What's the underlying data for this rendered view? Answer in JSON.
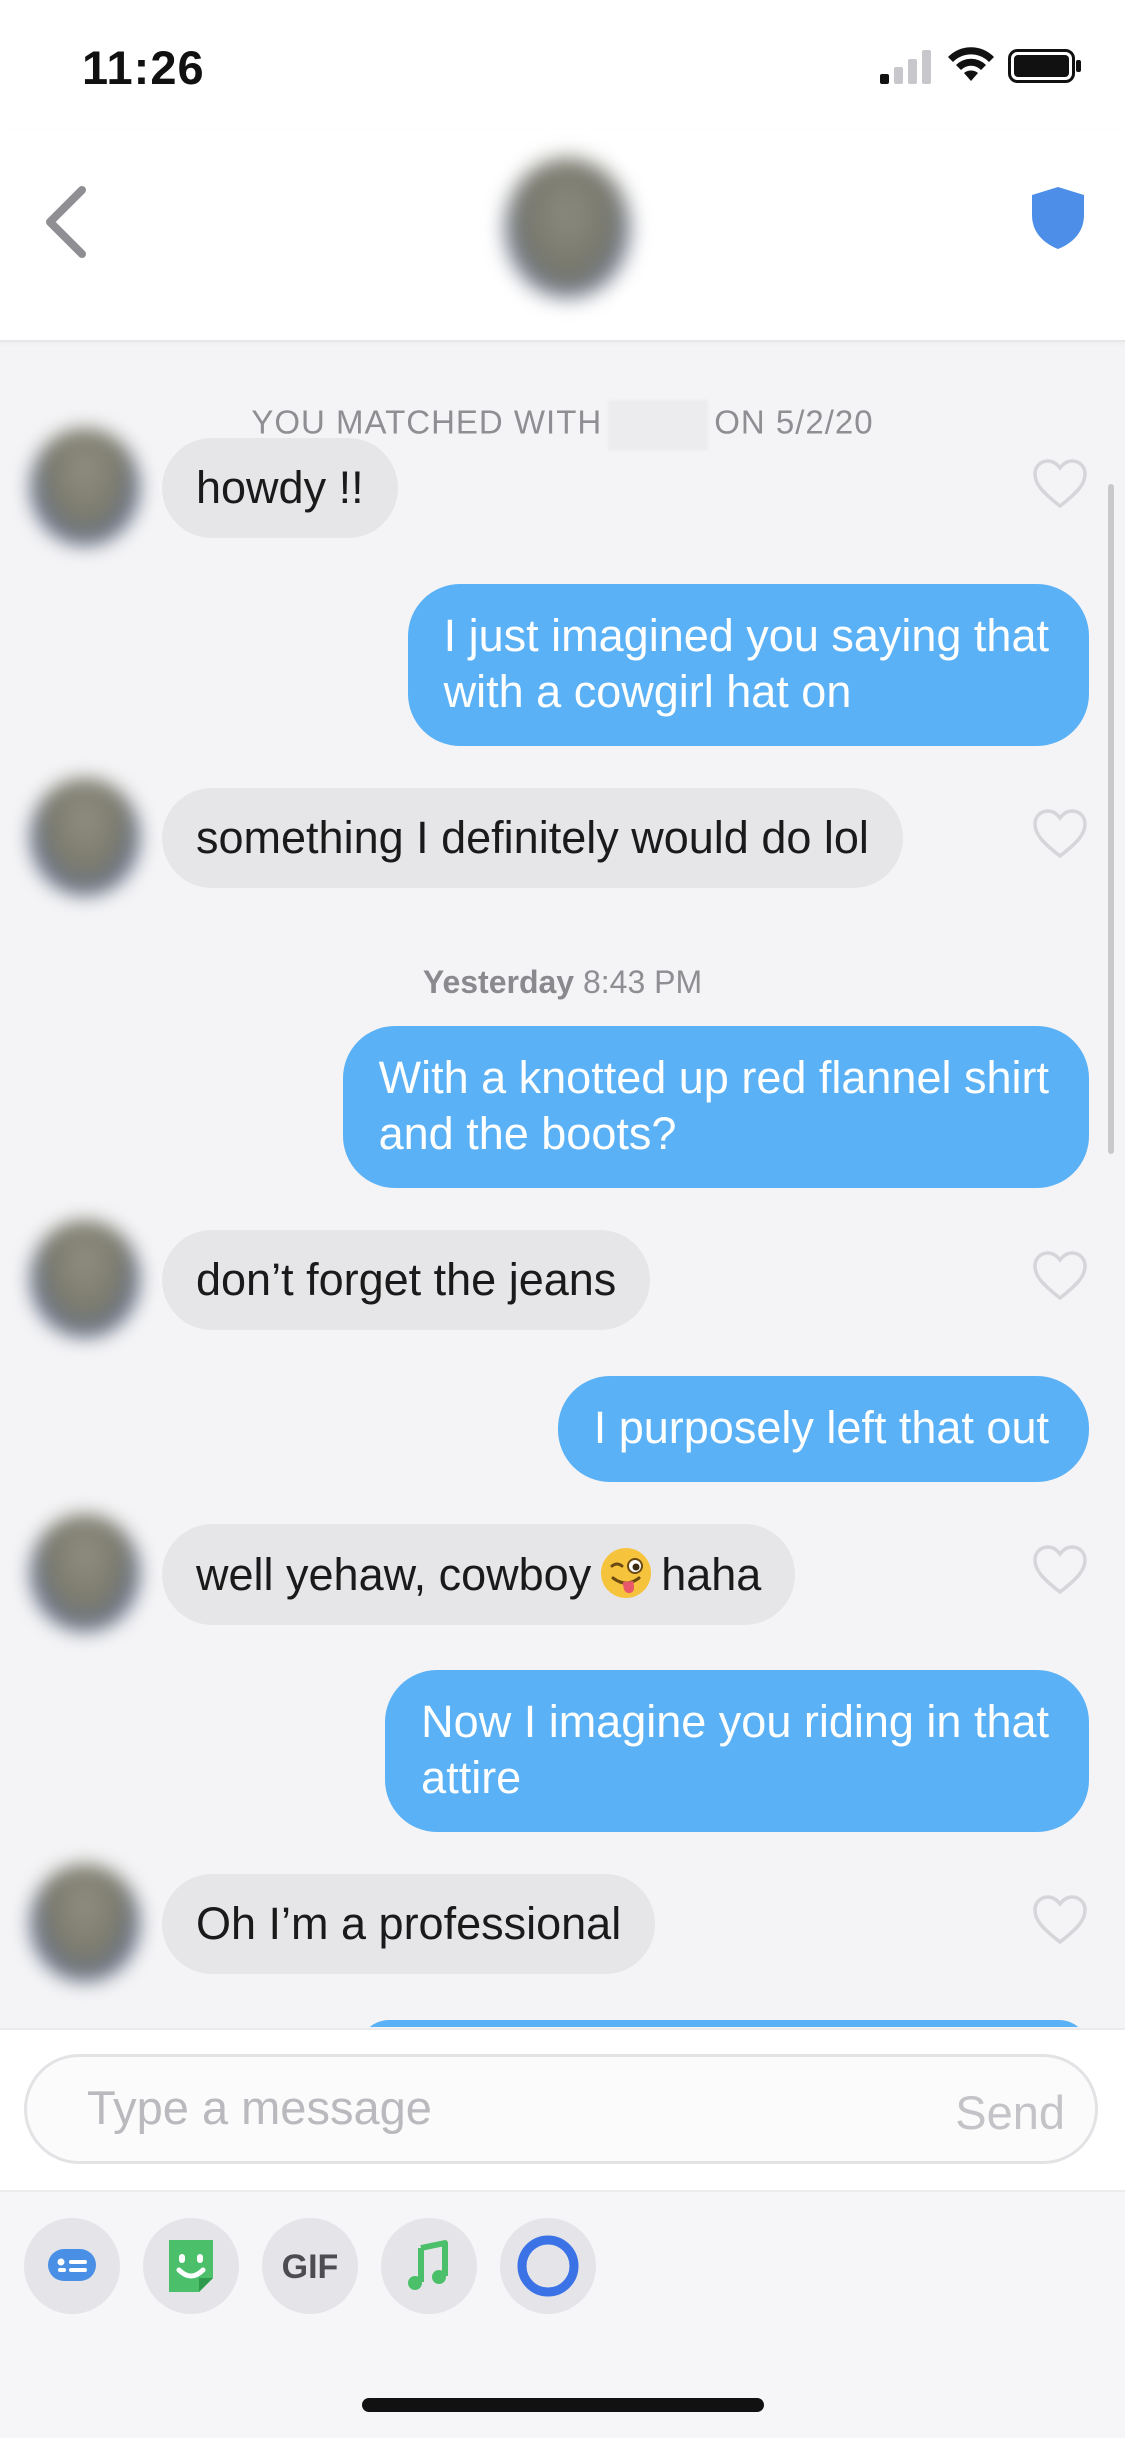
{
  "status_bar": {
    "time": "11:26"
  },
  "header": {
    "back_icon": "chevron-left-icon",
    "safety_icon": "shield-icon",
    "accent": "#4d8fe8"
  },
  "conversation": {
    "match_prefix": "YOU MATCHED WITH",
    "match_suffix": "ON 5/2/20",
    "day_label": "Yesterday",
    "day_time": "8:43 PM",
    "messages": [
      {
        "from": "them",
        "text": "howdy !!"
      },
      {
        "from": "me",
        "line1": "I just imagined you saying that",
        "line2": "with a cowgirl hat on"
      },
      {
        "from": "them",
        "text": "something I definitely would do lol"
      },
      {
        "from": "me",
        "line1": "With a knotted up red flannel shirt",
        "line2": "and the boots?"
      },
      {
        "from": "them",
        "text": "don’t forget the jeans"
      },
      {
        "from": "me",
        "text": "I purposely left that out"
      },
      {
        "from": "them",
        "before": "well yehaw, cowboy",
        "after": "haha",
        "emoji": "winking-face-with-tongue-emoji"
      },
      {
        "from": "me",
        "line1": "Now I imagine you riding in that",
        "line2": "attire"
      },
      {
        "from": "them",
        "text": "Oh I’m a professional"
      }
    ]
  },
  "composer": {
    "placeholder": "Type a message",
    "send_label": "Send"
  },
  "toolbar": {
    "gif_label": "GIF"
  },
  "colors": {
    "outgoing_bubble": "#5bb1f5",
    "incoming_bubble": "#e6e6e8"
  }
}
